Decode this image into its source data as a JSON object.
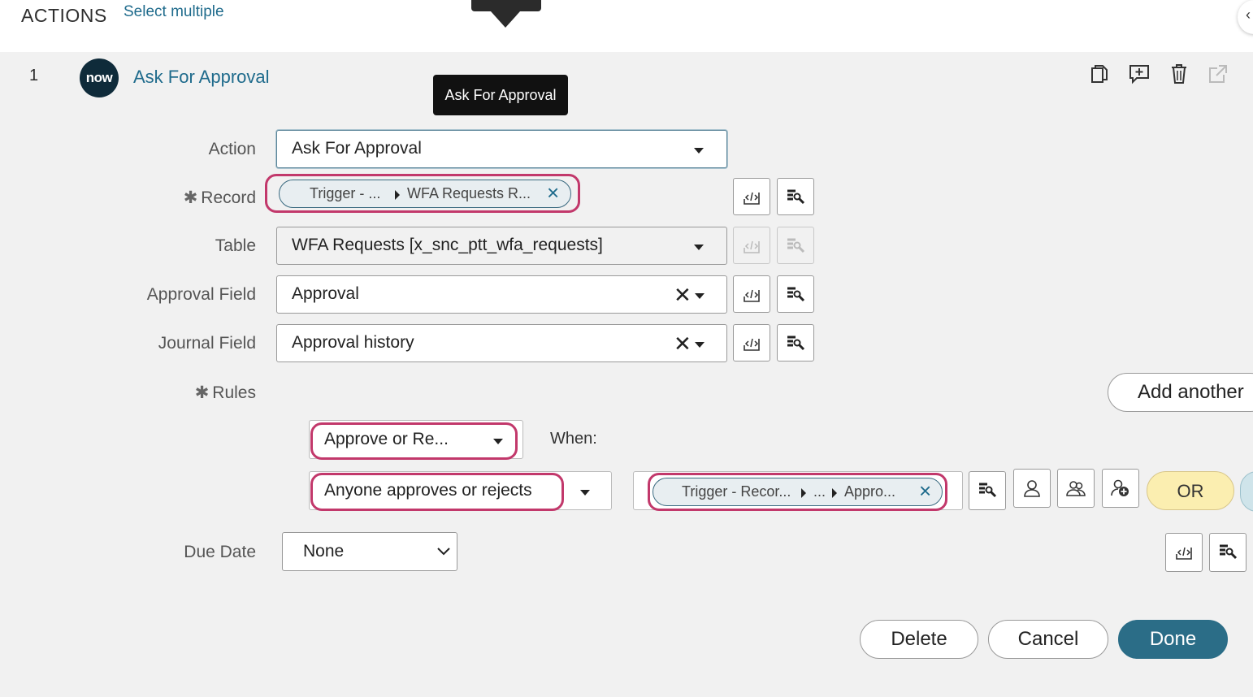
{
  "header": {
    "title": "ACTIONS",
    "select_multiple": "Select multiple"
  },
  "step": {
    "number": "1",
    "logo_text": "now",
    "title": "Ask For Approval",
    "tooltip": "Ask For Approval",
    "icons": [
      "copy-icon",
      "add-comment-icon",
      "trash-icon",
      "open-external-icon"
    ]
  },
  "form": {
    "action_label": "Action",
    "action_value": "Ask For Approval",
    "record_label": "Record",
    "record_pill": {
      "part1": "Trigger - ...",
      "part2": "WFA Requests R..."
    },
    "table_label": "Table",
    "table_value": "WFA Requests [x_snc_ptt_wfa_requests]",
    "approval_field_label": "Approval Field",
    "approval_field_value": "Approval",
    "journal_field_label": "Journal Field",
    "journal_field_value": "Approval history",
    "rules_label": "Rules",
    "add_another": "Add another",
    "rule_type": "Approve or Re...",
    "when_label": "When:",
    "condition": "Anyone approves or rejects",
    "rule_pill": {
      "part1": "Trigger - Recor...",
      "part2": "...",
      "part3": "Appro..."
    },
    "or_button": "OR",
    "due_date_label": "Due Date",
    "due_date_value": "None"
  },
  "footer": {
    "delete": "Delete",
    "cancel": "Cancel",
    "done": "Done"
  },
  "colors": {
    "link": "#1f6b8c",
    "highlight": "#c2386b",
    "primary": "#2b6d87",
    "or_bg": "#fbeeb0"
  }
}
